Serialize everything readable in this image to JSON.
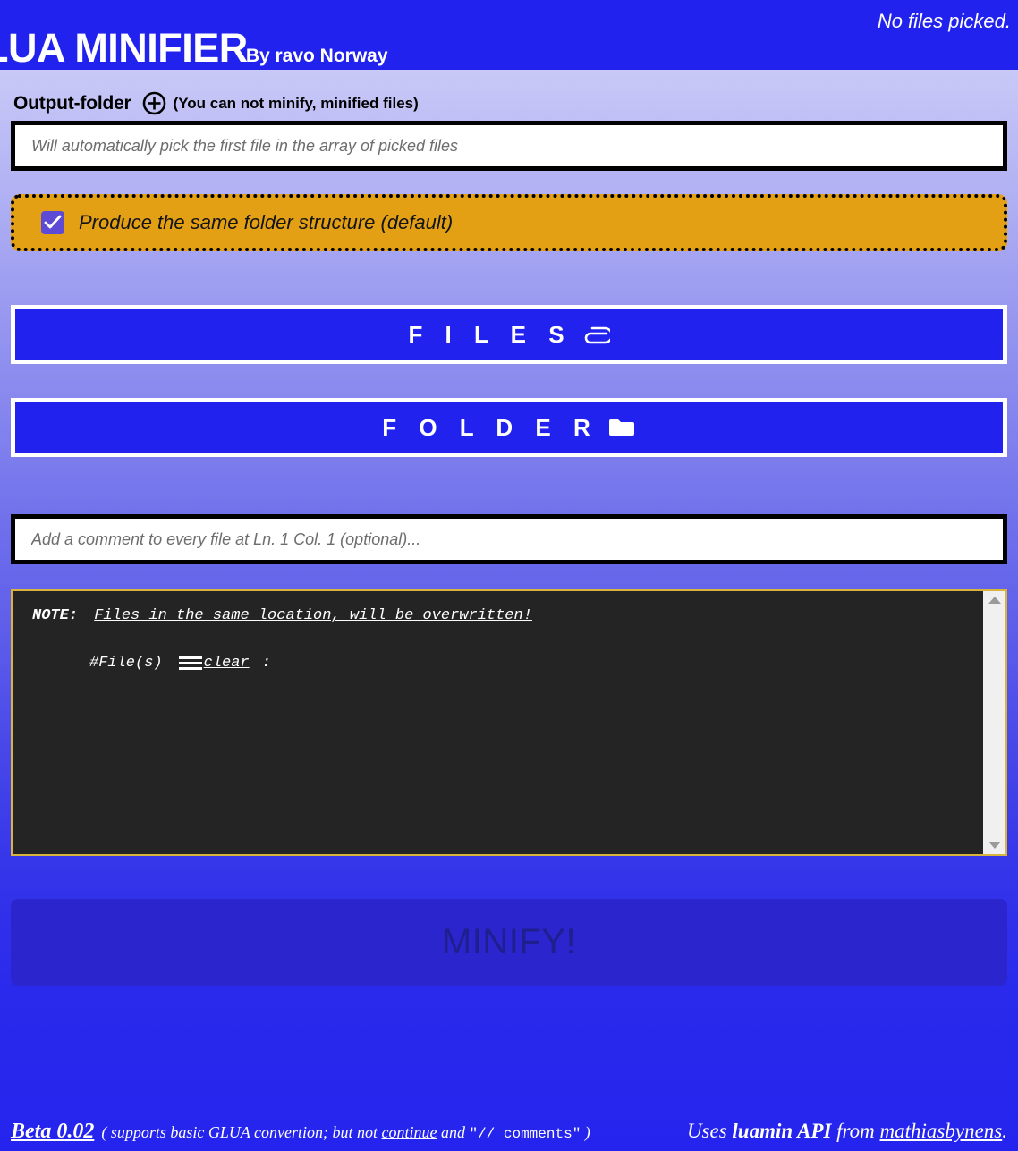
{
  "header": {
    "title": "LUA MINIFIER",
    "byline": "By ravo Norway",
    "files_status": "No files picked."
  },
  "output": {
    "label": "Output-folder",
    "plus_icon": "plus-circle-icon",
    "hint": "(You can not minify, minified files)",
    "field_placeholder": "Will automatically pick the first file in the array of picked files",
    "field_value": ""
  },
  "structure": {
    "checked": true,
    "label": "Produce the same folder structure (default)",
    "box_color": "#e3a015",
    "check_color": "#5d4bd6"
  },
  "buttons": {
    "files_label": "F I L E S",
    "files_icon": "paperclip-icon",
    "folder_label": "F O L D E R",
    "folder_icon": "folder-icon",
    "minify_label": "MINIFY!"
  },
  "comment": {
    "placeholder": "Add a comment to every file at Ln. 1 Col. 1 (optional)...",
    "value": ""
  },
  "note": {
    "prefix": "NOTE:",
    "message": "Files in the same location, will be overwritten!",
    "files_label": "#File(s)",
    "menu_icon": "hamburger-icon",
    "clear_label": "clear",
    "colon": ":",
    "scroll_up_icon": "triangle-up-icon",
    "scroll_down_icon": "triangle-down-icon",
    "bg_color": "#242424",
    "border_color": "#d8b43c"
  },
  "footer": {
    "beta": "Beta 0.02",
    "note_part1": "( supports basic GLUA convertion; but not ",
    "note_link": "continue",
    "note_part2": " and ",
    "note_code": "\"// comments\"",
    "note_part3": " )",
    "right_part1": "Uses ",
    "right_bold": "luamin API",
    "right_part2": " from ",
    "right_link": "mathiasbynens",
    "right_end": "."
  }
}
